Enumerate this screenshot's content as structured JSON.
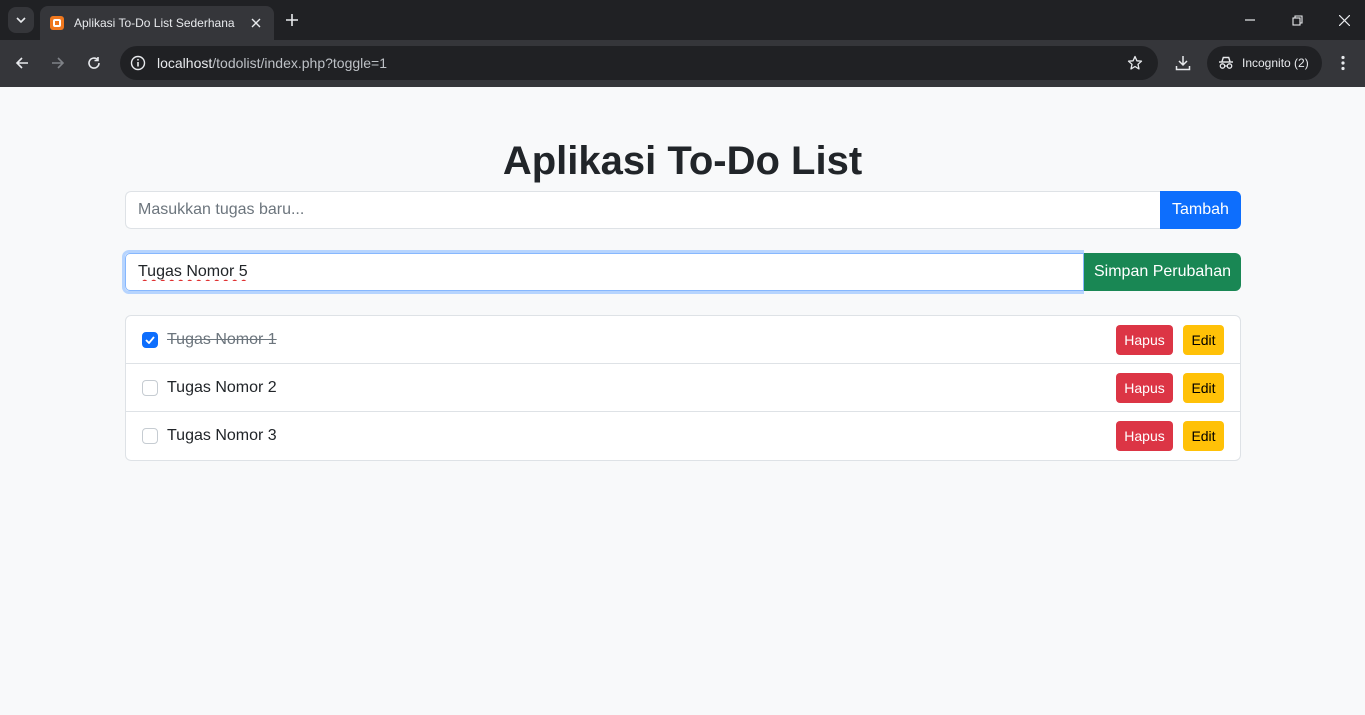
{
  "browser": {
    "tab_title": "Aplikasi To-Do List Sederhana",
    "url_host": "localhost",
    "url_path": "/todolist/index.php?toggle=1",
    "incognito_label": "Incognito (2)",
    "icons": {
      "tab_search": "chevron-down-icon",
      "favicon": "xampp-icon",
      "close_tab": "close-icon",
      "new_tab": "plus-icon",
      "back": "arrow-left-icon",
      "forward": "arrow-right-icon",
      "reload": "reload-icon",
      "site_info": "info-icon",
      "bookmark": "star-icon",
      "download": "download-icon",
      "incognito": "incognito-icon",
      "menu": "kebab-menu-icon",
      "minimize": "minimize-icon",
      "restore": "restore-icon",
      "close_window": "close-icon"
    }
  },
  "app": {
    "title": "Aplikasi To-Do List",
    "add_form": {
      "placeholder": "Masukkan tugas baru...",
      "value": "",
      "button_label": "Tambah"
    },
    "edit_form": {
      "value": "Tugas Nomor 5",
      "button_label": "Simpan Perubahan"
    },
    "tasks": [
      {
        "text": "Tugas Nomor 1",
        "done": true,
        "delete_label": "Hapus",
        "edit_label": "Edit"
      },
      {
        "text": "Tugas Nomor 2",
        "done": false,
        "delete_label": "Hapus",
        "edit_label": "Edit"
      },
      {
        "text": "Tugas Nomor 3",
        "done": false,
        "delete_label": "Hapus",
        "edit_label": "Edit"
      }
    ]
  },
  "colors": {
    "primary": "#0d6efd",
    "success": "#198754",
    "danger": "#dc3545",
    "warning": "#ffc107",
    "page_bg": "#f8f9fa"
  }
}
